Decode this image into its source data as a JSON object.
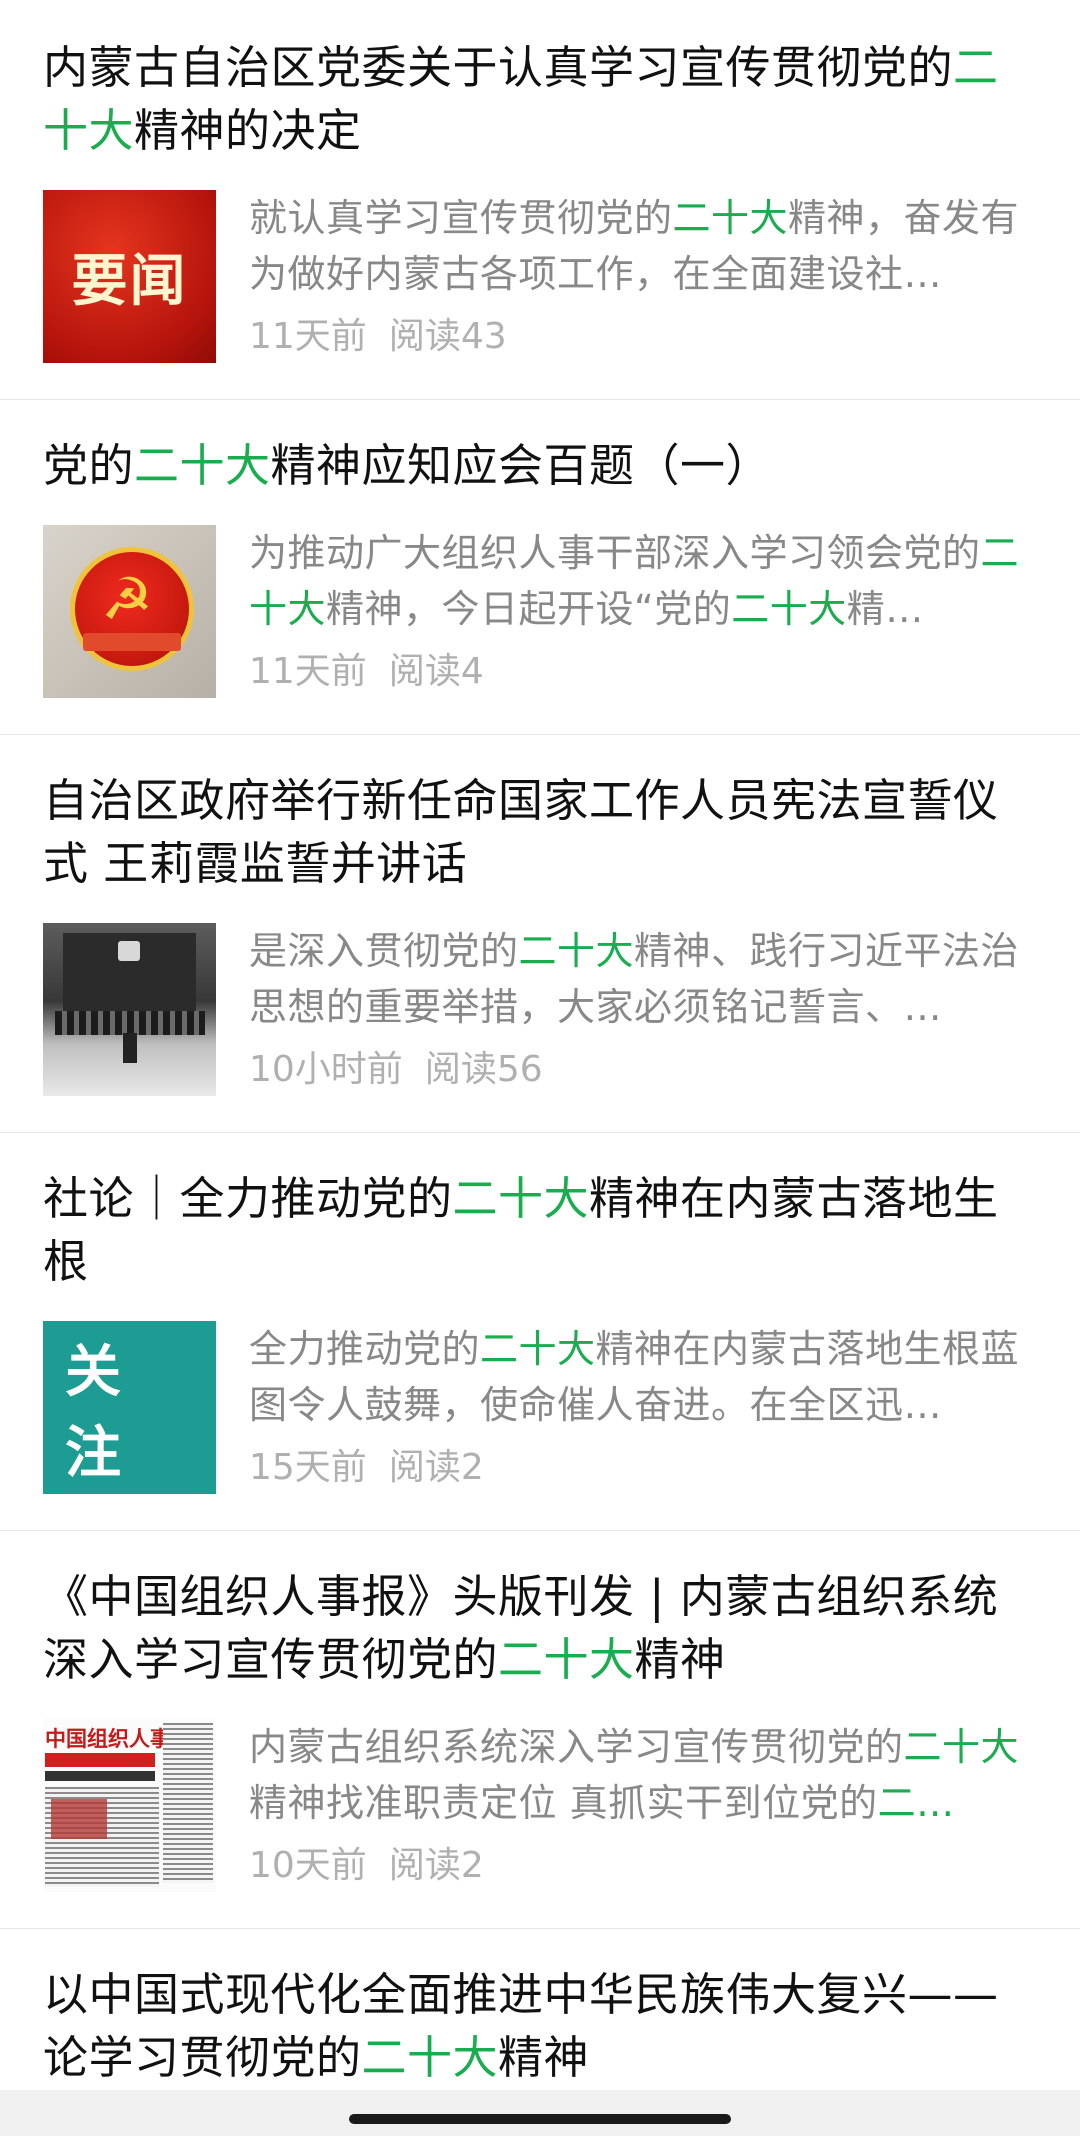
{
  "articles": [
    {
      "title": [
        {
          "t": "内蒙古自治区党委关于认真学习宣传贯彻党的"
        },
        {
          "t": "二十大",
          "hl": true
        },
        {
          "t": "精神的决定"
        }
      ],
      "summary": [
        {
          "t": "就认真学习宣传贯彻党的"
        },
        {
          "t": "二十大",
          "hl": true
        },
        {
          "t": "精神，奋发有为做好内蒙古各项工作，在全面建设社…"
        }
      ],
      "time": "11天前",
      "reads": "阅读43",
      "thumb_text": "要闻",
      "thumb_type": "red-banner"
    },
    {
      "title": [
        {
          "t": "党的"
        },
        {
          "t": "二十大",
          "hl": true
        },
        {
          "t": "精神应知应会百题（一）"
        }
      ],
      "summary": [
        {
          "t": "为推动广大组织人事干部深入学习领会党的"
        },
        {
          "t": "二十大",
          "hl": true
        },
        {
          "t": "精神，今日起开设“党的"
        },
        {
          "t": "二十大",
          "hl": true
        },
        {
          "t": "精…"
        }
      ],
      "time": "11天前",
      "reads": "阅读4",
      "thumb_type": "party-badge"
    },
    {
      "title": [
        {
          "t": "自治区政府举行新任命国家工作人员宪法宣誓仪式 王莉霞监誓并讲话"
        }
      ],
      "summary": [
        {
          "t": "是深入贯彻党的"
        },
        {
          "t": "二十大",
          "hl": true
        },
        {
          "t": "精神、践行习近平法治思想的重要举措，大家必须铭记誓言、…"
        }
      ],
      "time": "10小时前",
      "reads": "阅读56",
      "thumb_type": "ceremony-photo"
    },
    {
      "title": [
        {
          "t": "社论｜全力推动党的"
        },
        {
          "t": "二十大",
          "hl": true
        },
        {
          "t": "精神在内蒙古落地生根"
        }
      ],
      "summary": [
        {
          "t": "全力推动党的"
        },
        {
          "t": "二十大",
          "hl": true
        },
        {
          "t": "精神在内蒙古落地生根蓝图令人鼓舞，使命催人奋进。在全区迅…"
        }
      ],
      "time": "15天前",
      "reads": "阅读2",
      "thumb_text": "关注",
      "thumb_type": "teal-banner"
    },
    {
      "title": [
        {
          "t": "《中国组织人事报》头版刊发 | 内蒙古组织系统深入学习宣传贯彻党的"
        },
        {
          "t": "二十大",
          "hl": true
        },
        {
          "t": "精神"
        }
      ],
      "summary": [
        {
          "t": "内蒙古组织系统深入学习宣传贯彻党的"
        },
        {
          "t": "二十大",
          "hl": true
        },
        {
          "t": "精神找准职责定位 真抓实干到位党的"
        },
        {
          "t": "二…",
          "hl": true
        }
      ],
      "time": "10天前",
      "reads": "阅读2",
      "thumb_text": "中国组织人事报",
      "thumb_type": "newspaper"
    },
    {
      "title": [
        {
          "t": "以中国式现代化全面推进中华民族伟大复兴——论学习贯彻党的"
        },
        {
          "t": "二十大",
          "hl": true
        },
        {
          "t": "精神"
        }
      ]
    }
  ],
  "colors": {
    "highlight": "#1aad4f",
    "title": "#111111",
    "summary": "#888888",
    "meta": "#b0b0b0"
  }
}
